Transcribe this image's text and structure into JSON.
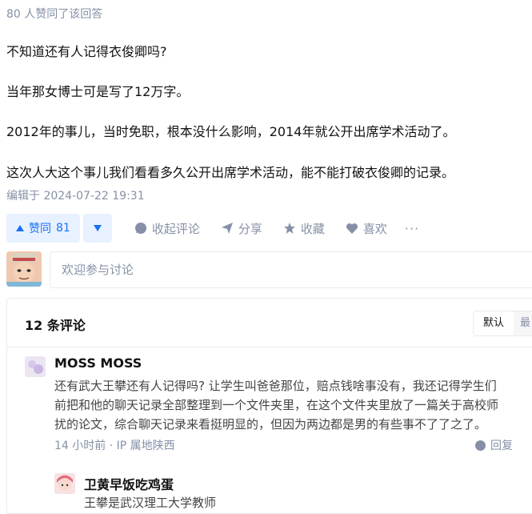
{
  "answer": {
    "likers": "80 人赞同了该回答",
    "paragraphs": [
      "不知道还有人记得衣俊卿吗?",
      "当年那女博士可是写了12万字。",
      "2012年的事儿，当时免职，根本没什么影响，2014年就公开出席学术活动了。",
      "这次人大这个事儿我们看看多久公开出席学术活动，能不能打破衣俊卿的记录。"
    ],
    "edited": "编辑于 2024-07-22 19:31"
  },
  "actions": {
    "vote_up_label": "赞同",
    "vote_up_count": "81",
    "collapse_comments": "收起评论",
    "share": "分享",
    "collect": "收藏",
    "like": "喜欢",
    "more": "···"
  },
  "comment_box": {
    "placeholder": "欢迎参与讨论"
  },
  "comments": {
    "title": "12 条评论",
    "sort_default": "默认",
    "sort_other": "最",
    "items": [
      {
        "name": "MOSS MOSS",
        "lines": [
          "还有武大王攀还有人记得吗? 让学生叫爸爸那位，赔点钱啥事没有，我还记得学生们",
          "前把和他的聊天记录全部整理到一个文件夹里，在这个文件夹里放了一篇关于高校师",
          "扰的论文，综合聊天记录来看挺明显的，但因为两边都是男的有些事不了了之了。"
        ],
        "meta": "14 小时前 · IP 属地陕西",
        "reply": "回复"
      },
      {
        "name": "卫黄早饭吃鸡蛋",
        "lines": [
          "王攀是武汉理工大学教师"
        ]
      }
    ]
  },
  "colors": {
    "accent": "#1772f6",
    "accent_bg": "#e8f1ff",
    "muted": "#8590a6",
    "border": "#ebebeb"
  }
}
